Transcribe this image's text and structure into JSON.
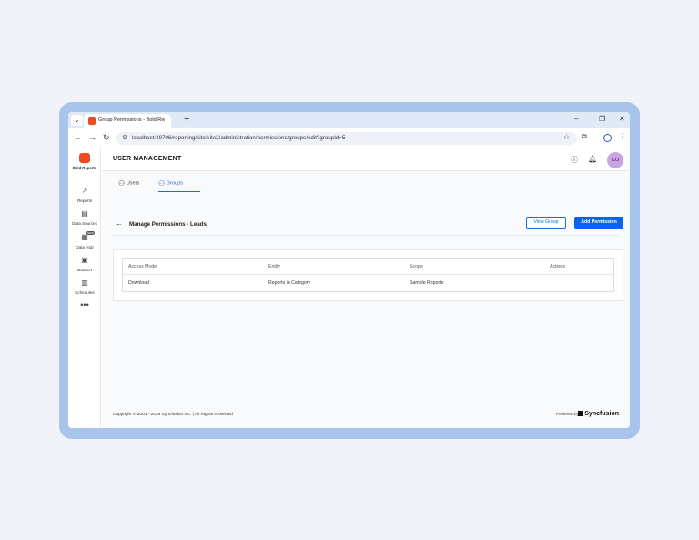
{
  "browser": {
    "tab_title": "Group Permissions - Bold Repo",
    "new_tab": "+",
    "url": "localhost:49706/reporting/site/site2/administration/permissions/groups/edit?groupId=5",
    "controls": {
      "minimize": "–",
      "restore": "❐",
      "close": "✕"
    },
    "nav": {
      "back": "←",
      "forward": "→",
      "reload": "↻"
    }
  },
  "sidebar": {
    "brand": "Bold Reports",
    "items": [
      {
        "label": "Reports",
        "icon": "trend-icon"
      },
      {
        "label": "Data Sources",
        "icon": "database-icon"
      },
      {
        "label": "Data Hub",
        "icon": "datahub-icon",
        "badge": "NEW"
      },
      {
        "label": "Dataset",
        "icon": "dataset-icon"
      },
      {
        "label": "Schedules",
        "icon": "calendar-icon"
      }
    ],
    "more": "•••"
  },
  "header": {
    "title": "USER MANAGEMENT",
    "avatar_initials": "CO"
  },
  "tabs": [
    {
      "label": "Users"
    },
    {
      "label": "Groups"
    }
  ],
  "subheader": {
    "title": "Manage Permissions - Leads",
    "view_group": "View Group",
    "add_permission": "Add Permission"
  },
  "table": {
    "columns": [
      "Access Mode",
      "Entity",
      "Scope",
      "Actions"
    ],
    "rows": [
      [
        "Download",
        "Reports in Category",
        "Sample Reports",
        ""
      ]
    ]
  },
  "footer": {
    "copyright": "Copyright © 2001 - 2026 Syncfusion Inc.  |  All Rights Reserved",
    "powered_by": "Powered by",
    "brand": "Syncfusion"
  },
  "colors": {
    "accent": "#0a64e8",
    "frame": "#a9c4eb",
    "brand": "#ef4b22",
    "avatar": "#c9a5e8"
  }
}
